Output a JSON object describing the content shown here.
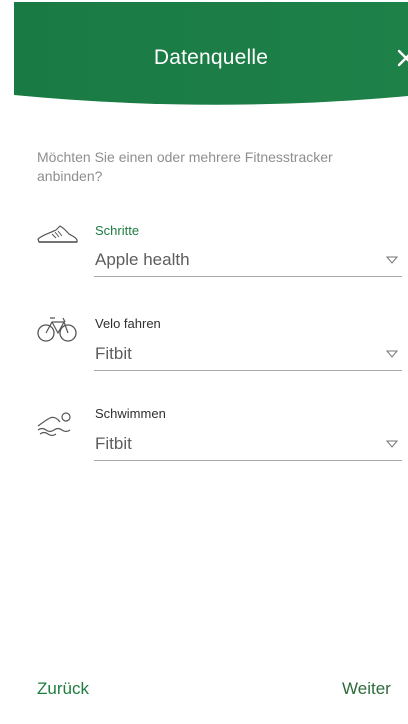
{
  "header": {
    "title": "Datenquelle",
    "close_icon": "close-icon",
    "background_color": "#1b7d45"
  },
  "intro_text": "Möchten Sie einen oder mehrere Fitnesstracker anbinden?",
  "activities": [
    {
      "icon": "shoe-icon",
      "label": "Schritte",
      "selected_source": "Apple health",
      "label_color": "#1e7d3f"
    },
    {
      "icon": "bicycle-icon",
      "label": "Velo fahren",
      "selected_source": "Fitbit",
      "label_color": "#2f2f2f"
    },
    {
      "icon": "swimmer-icon",
      "label": "Schwimmen",
      "selected_source": "Fitbit",
      "label_color": "#2f2f2f"
    }
  ],
  "footer": {
    "back_label": "Zurück",
    "next_label": "Weiter"
  },
  "colors": {
    "accent_green": "#1e7d3f",
    "header_green": "#1b7d45"
  }
}
